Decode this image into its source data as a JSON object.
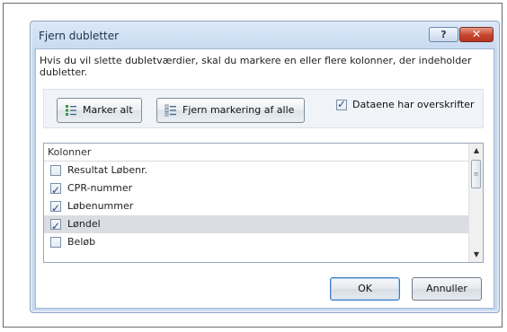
{
  "dialog": {
    "title": "Fjern dubletter",
    "help_label": "?",
    "close_label": "✕",
    "description": "Hvis du vil slette dubletværdier, skal du markere en eller flere kolonner, der indeholder dubletter."
  },
  "toolbar": {
    "select_all_label": "Marker alt",
    "deselect_all_label": "Fjern markering af alle",
    "headers_label": "Dataene har overskrifter",
    "headers_checked": true
  },
  "columns": {
    "header": "Kolonner",
    "items": [
      {
        "label": "Resultat Løbenr.",
        "checked": false,
        "selected": false
      },
      {
        "label": "CPR-nummer",
        "checked": true,
        "selected": false
      },
      {
        "label": "Løbenummer",
        "checked": true,
        "selected": false
      },
      {
        "label": "Løndel",
        "checked": true,
        "selected": true
      },
      {
        "label": "Beløb",
        "checked": false,
        "selected": false
      }
    ]
  },
  "buttons": {
    "ok_label": "OK",
    "cancel_label": "Annuller"
  },
  "colors": {
    "title_bar": "#c9dbf1",
    "close_button": "#c7442e",
    "selected_row": "#dadde2"
  }
}
